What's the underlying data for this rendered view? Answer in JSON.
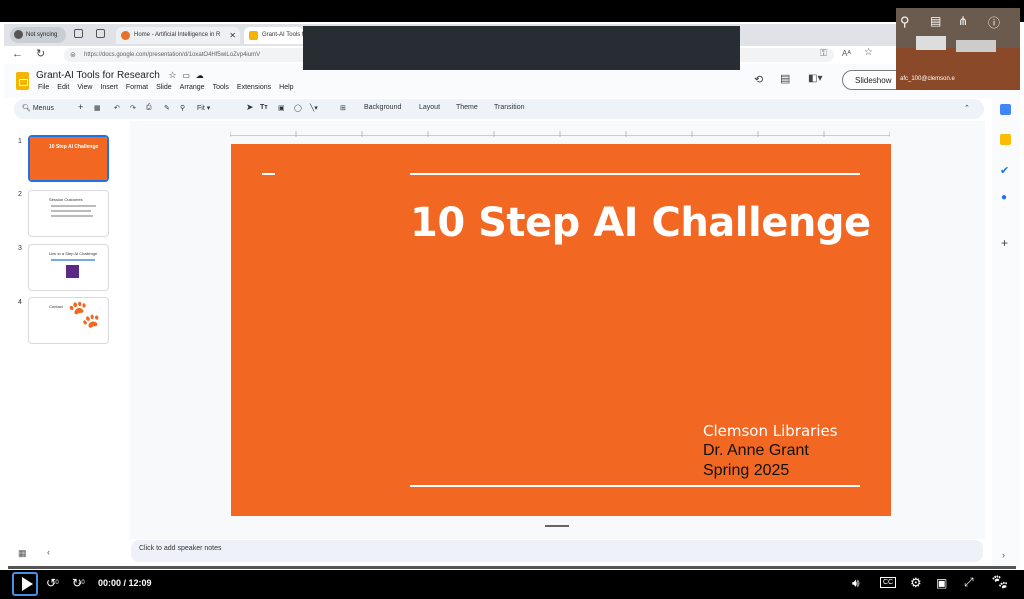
{
  "browser": {
    "sync_pill": "Not syncing",
    "tabs": [
      {
        "label": "Home - Artificial Intelligence in R",
        "color": "#e8702a"
      },
      {
        "label": "Grant-AI Tools f",
        "color": "#f4b400"
      }
    ],
    "url": "https://docs.google.com/presentation/d/1oxatO4Hf5wiLoZvp4iumV"
  },
  "docs": {
    "title": "Grant-AI Tools for Research",
    "menu": [
      "File",
      "Edit",
      "View",
      "Insert",
      "Format",
      "Slide",
      "Arrange",
      "Tools",
      "Extensions",
      "Help"
    ],
    "slideshow_label": "Slideshow",
    "account": "afc_100@clemson.e"
  },
  "toolbar": {
    "menus": "Menus",
    "zoom": "Fit",
    "background": "Background",
    "layout": "Layout",
    "theme": "Theme",
    "transition": "Transition"
  },
  "filmstrip": [
    {
      "num": "1",
      "title": "10 Step AI Challenge"
    },
    {
      "num": "2",
      "title": "Session Outcomes"
    },
    {
      "num": "3",
      "title": "Link to a Step AI Challenge"
    },
    {
      "num": "4",
      "title": "Contact"
    }
  ],
  "slide": {
    "title": "10 Step AI Challenge",
    "org": "Clemson Libraries",
    "presenter": "Dr. Anne Grant",
    "term": "Spring 2025",
    "bg_color": "#f26722"
  },
  "notes_placeholder": "Click to add speaker notes",
  "player": {
    "time": "00:00 / 12:09",
    "skip_back": "10",
    "skip_forward": "10",
    "cc": "CC"
  }
}
